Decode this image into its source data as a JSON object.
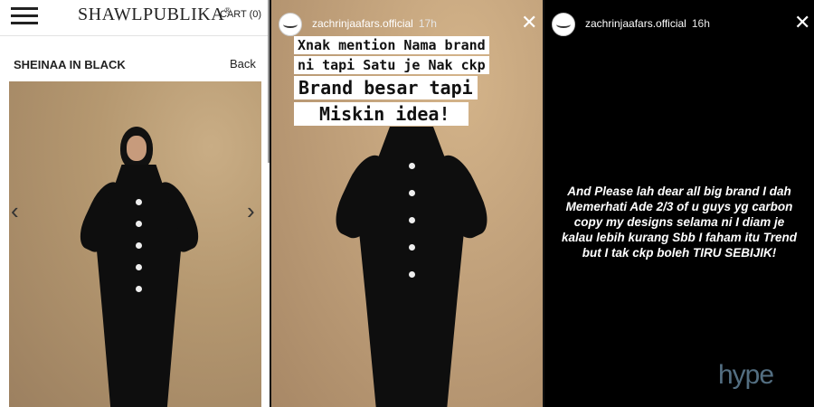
{
  "shop": {
    "brand": "SHAWLPUBLIKA",
    "brand_mark": "®",
    "cart_label": "CART (0)",
    "product_title": "SHEINAA IN BLACK",
    "back_label": "Back",
    "prev_arrow": "‹",
    "next_arrow": "›"
  },
  "story1": {
    "username": "zachrinjaafars.official",
    "time_ago": "17h",
    "close_glyph": "✕",
    "caption_lines": [
      "Xnak mention Nama brand",
      "ni tapi Satu je Nak ckp",
      "Brand besar tapi",
      "Miskin idea!"
    ]
  },
  "story2": {
    "username": "zachrinjaafars.official",
    "time_ago": "16h",
    "close_glyph": "✕",
    "message": "And  Please lah dear all big brand I dah Memerhati   Ade 2/3 of u guys yg carbon copy my designs selama ni I diam je kalau lebih kurang Sbb I faham itu Trend but I tak ckp boleh TIRU SEBIJIK!"
  },
  "watermark": "hype",
  "colors": {
    "beige_backdrop": "#c0a07a",
    "dress": "#0e0e0e",
    "story_bg": "#000000",
    "watermark": "#8ab8d8"
  }
}
